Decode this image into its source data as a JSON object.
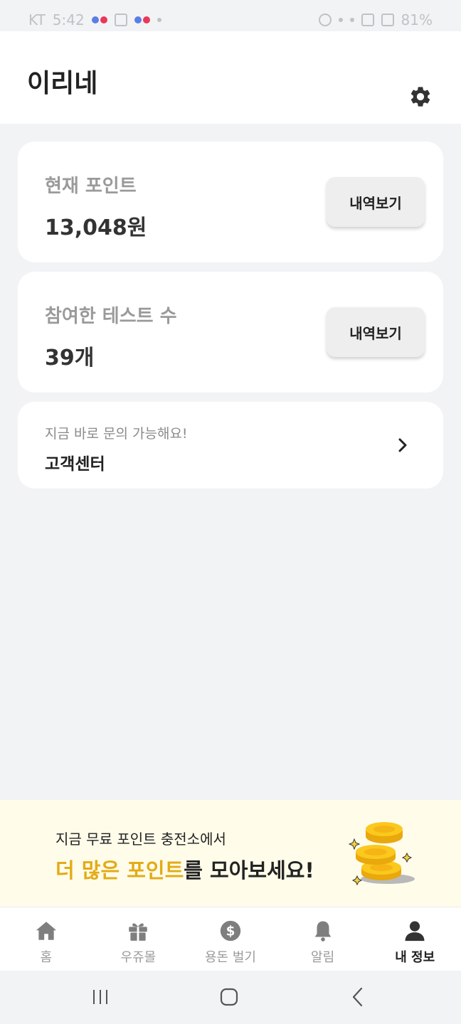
{
  "status_bar": {
    "carrier": "KT",
    "time": "5:42",
    "battery": "81%"
  },
  "header": {
    "title": "이리네",
    "settings_icon": "gear-icon"
  },
  "points_card": {
    "label": "현재 포인트",
    "value": "13,048원",
    "button_label": "내역보기"
  },
  "tests_card": {
    "label": "참여한 테스트 수",
    "value": "39개",
    "button_label": "내역보기"
  },
  "support_card": {
    "subtitle": "지금 바로 문의 가능해요!",
    "title": "고객센터",
    "icon": "chevron-right-icon"
  },
  "banner": {
    "line1": "지금 무료 포인트 충전소에서",
    "line2_highlight": "더 많은 포인트",
    "line2_rest": "를 모아보세요!",
    "highlight_color": "#e3ab16",
    "background": "#fffcea"
  },
  "tabs": [
    {
      "label": "홈",
      "icon": "home-icon",
      "active": false
    },
    {
      "label": "우쥬몰",
      "icon": "gift-icon",
      "active": false
    },
    {
      "label": "용돈 벌기",
      "icon": "dollar-coin-icon",
      "active": false
    },
    {
      "label": "알림",
      "icon": "bell-icon",
      "active": false
    },
    {
      "label": "내 정보",
      "icon": "person-icon",
      "active": true
    }
  ],
  "system_nav": [
    "recents-icon",
    "home-button-icon",
    "back-icon"
  ]
}
